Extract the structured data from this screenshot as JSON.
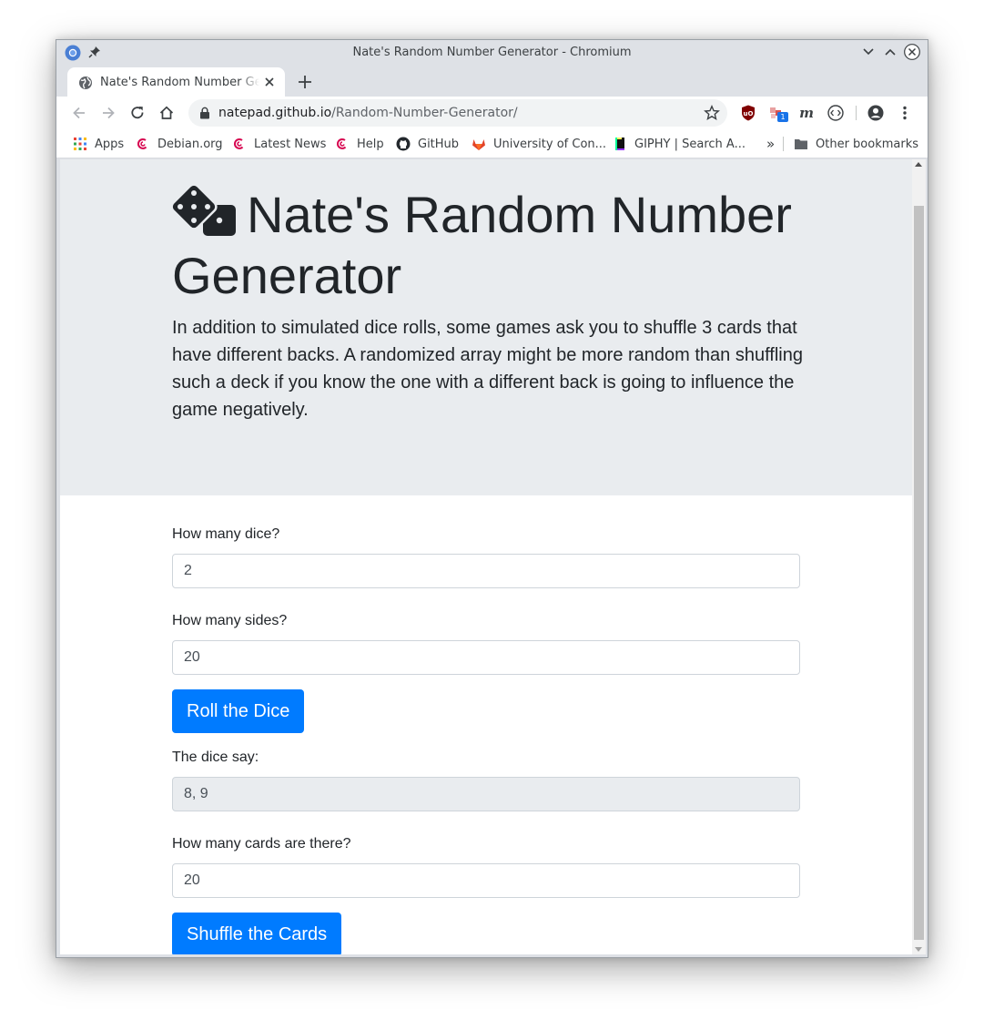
{
  "window": {
    "title": "Nate's Random Number Generator - Chromium"
  },
  "tab": {
    "title": "Nate's Random Number Generator"
  },
  "omnibox": {
    "host": "natepad.github.io",
    "path": "/Random-Number-Generator/"
  },
  "extensions": {
    "badge_count": "1"
  },
  "bookmarks": [
    {
      "label": "Apps",
      "icon": "apps-grid-icon"
    },
    {
      "label": "Debian.org",
      "icon": "debian-icon"
    },
    {
      "label": "Latest News",
      "icon": "debian-icon"
    },
    {
      "label": "Help",
      "icon": "debian-icon"
    },
    {
      "label": "GitHub",
      "icon": "github-icon"
    },
    {
      "label": "University of Con...",
      "icon": "gitlab-icon"
    },
    {
      "label": "GIPHY | Search A...",
      "icon": "giphy-icon"
    }
  ],
  "bookmarks_overflow": "»",
  "other_bookmarks": "Other bookmarks",
  "page": {
    "title": "Nate's Random Number Generator",
    "lead": "In addition to simulated dice rolls, some games ask you to shuffle 3 cards that have different backs. A randomized array might be more random than shuffling such a deck if you know the one with a different back is going to influence the game negatively.",
    "dice_label": "How many dice?",
    "dice_value": "2",
    "sides_label": "How many sides?",
    "sides_value": "20",
    "roll_button": "Roll the Dice",
    "result_label": "The dice say:",
    "result_value": "8, 9",
    "cards_label": "How many cards are there?",
    "cards_value": "20",
    "shuffle_button": "Shuffle the Cards"
  },
  "colors": {
    "primary": "#007bff",
    "jumbotron": "#e9ecef",
    "text": "#212529"
  }
}
